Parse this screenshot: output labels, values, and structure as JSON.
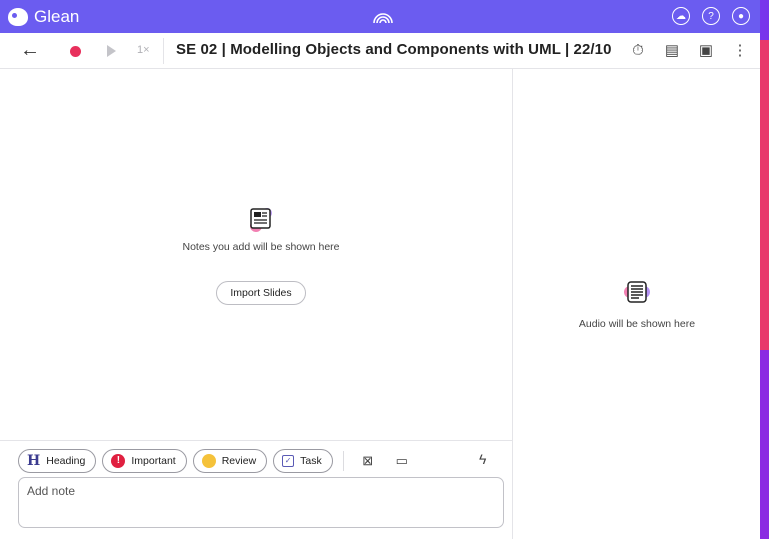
{
  "app": {
    "name": "Glean"
  },
  "toolbar": {
    "speed": "1×",
    "title": "SE 02 | Modelling Objects and Components with UML | 22/10"
  },
  "notes_pane": {
    "empty_message": "Notes you add will be shown here",
    "import_button": "Import Slides"
  },
  "audio_pane": {
    "empty_message": "Audio will be shown here"
  },
  "composer": {
    "chips": [
      {
        "label": "Heading",
        "icon": "heading-icon"
      },
      {
        "label": "Important",
        "icon": "exclamation-icon"
      },
      {
        "label": "Review",
        "icon": "thinking-face-icon"
      },
      {
        "label": "Task",
        "icon": "checkbox-icon"
      }
    ],
    "input_placeholder": "Add note"
  },
  "colors": {
    "appbar": "#6b5cf0",
    "record": "#e8305c",
    "important": "#e02040",
    "review": "#f5c23a"
  }
}
